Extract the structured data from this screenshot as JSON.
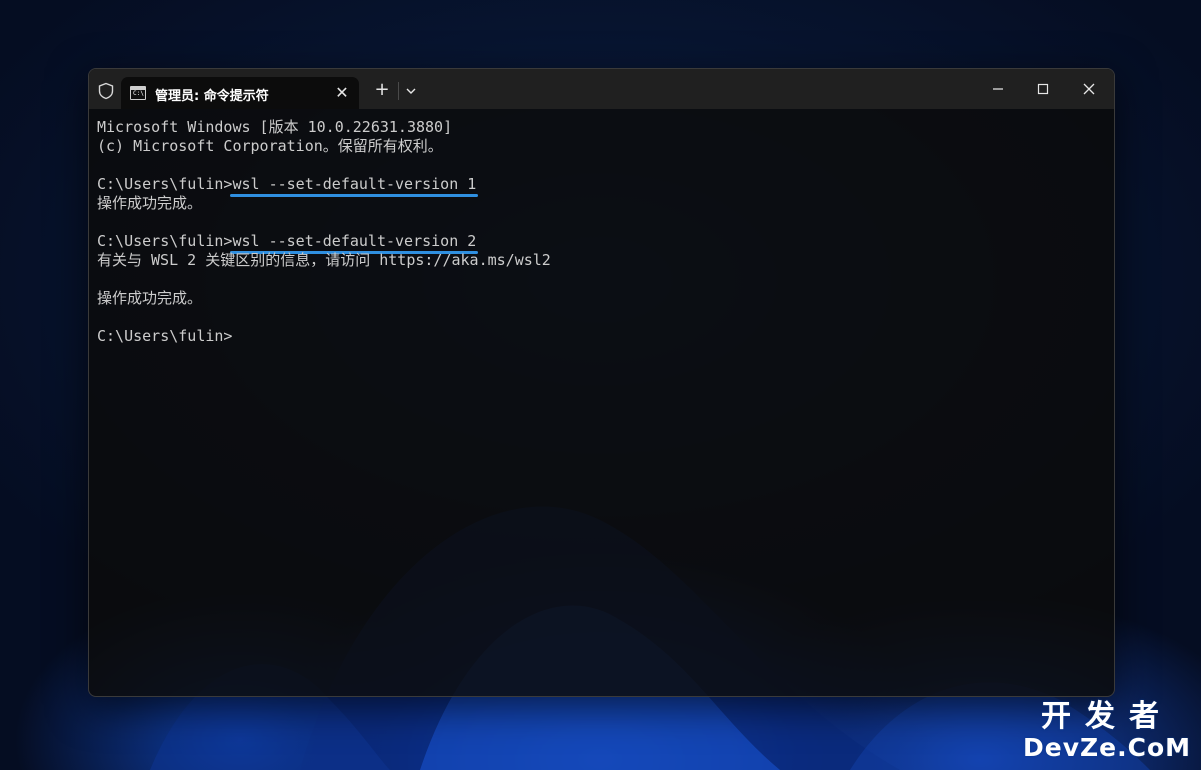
{
  "window": {
    "tab_title": "管理员: 命令提示符",
    "tab_icon_text": "C:\\",
    "close_tab_glyph": "✕",
    "new_tab_glyph": "+"
  },
  "terminal": {
    "lines": [
      {
        "prompt": "Microsoft Windows [版本 10.0.22631.3880]",
        "cmd": ""
      },
      {
        "prompt": "(c) Microsoft Corporation。保留所有权利。",
        "cmd": ""
      },
      {
        "prompt": "",
        "cmd": ""
      },
      {
        "prompt": "C:\\Users\\fulin>",
        "cmd": "wsl --set-default-version 1"
      },
      {
        "prompt": "操作成功完成。",
        "cmd": ""
      },
      {
        "prompt": "",
        "cmd": ""
      },
      {
        "prompt": "C:\\Users\\fulin>",
        "cmd": "wsl --set-default-version 2"
      },
      {
        "prompt": "有关与 WSL 2 关键区别的信息，请访问 https://aka.ms/wsl2",
        "cmd": ""
      },
      {
        "prompt": "",
        "cmd": ""
      },
      {
        "prompt": "操作成功完成。",
        "cmd": ""
      },
      {
        "prompt": "",
        "cmd": ""
      },
      {
        "prompt": "C:\\Users\\fulin>",
        "cmd": ""
      }
    ]
  },
  "watermark": {
    "cn": "开发者",
    "en": "DevZe.CoM"
  },
  "colors": {
    "highlight": "#2f8fe0",
    "terminal_text": "#cccccc",
    "titlebar": "#202020"
  },
  "icons": [
    "shield-icon",
    "cmd-icon",
    "close-icon",
    "plus-icon",
    "chevron-down-icon",
    "minimize-icon",
    "maximize-icon",
    "window-close-icon"
  ]
}
